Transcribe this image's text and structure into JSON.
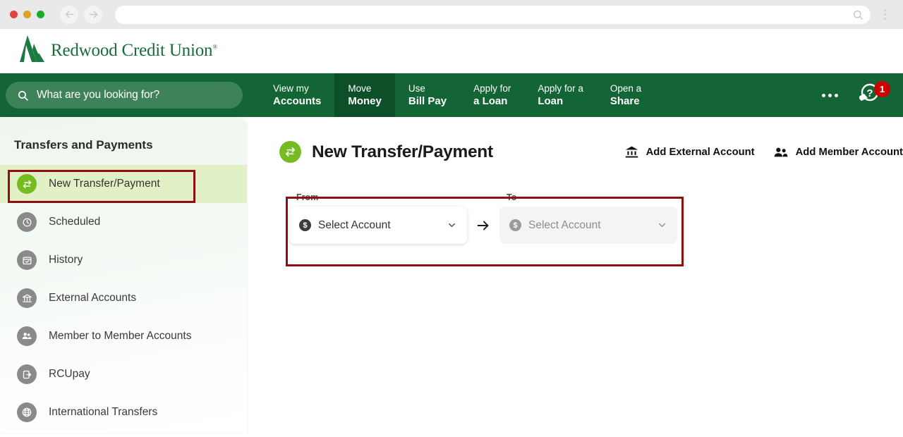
{
  "browser": {
    "back_label": "Back",
    "forward_label": "Forward",
    "url_value": "",
    "url_placeholder": "",
    "menu_label": "Browser menu"
  },
  "brand": {
    "name": "Redwood Credit Union",
    "trademark": "®",
    "green": "#1a6b3c"
  },
  "topnav": {
    "background": "#136535",
    "active_background": "#0d4f28",
    "search": {
      "placeholder": "What are you looking for?",
      "value": ""
    },
    "items": [
      {
        "line1": "View my",
        "line2": "Accounts",
        "active": false
      },
      {
        "line1": "Move",
        "line2": "Money",
        "active": true
      },
      {
        "line1": "Use",
        "line2": "Bill Pay",
        "active": false
      },
      {
        "line1": "Apply for",
        "line2": "a Loan",
        "active": false
      },
      {
        "line1": "Apply for a",
        "line2": "Loan",
        "active": false
      },
      {
        "line1": "Open a",
        "line2": "Share",
        "active": false
      }
    ],
    "more_label": "More",
    "help": {
      "label": "Help and chat",
      "badge_count": "1",
      "badge_color": "#cc0000"
    }
  },
  "sidebar": {
    "title": "Transfers and Payments",
    "active_background": "#e2f0c6",
    "active_icon_color": "#76bc21",
    "items": [
      {
        "label": "New Transfer/Payment",
        "icon": "transfer-arrows-icon",
        "active": true
      },
      {
        "label": "Scheduled",
        "icon": "clock-icon",
        "active": false
      },
      {
        "label": "History",
        "icon": "calendar-check-icon",
        "active": false
      },
      {
        "label": "External Accounts",
        "icon": "bank-icon",
        "active": false
      },
      {
        "label": "Member to Member Accounts",
        "icon": "people-icon",
        "active": false
      },
      {
        "label": "RCUpay",
        "icon": "payment-card-icon",
        "active": false
      },
      {
        "label": "International Transfers",
        "icon": "globe-icon",
        "active": false
      }
    ]
  },
  "main": {
    "page_title": "New Transfer/Payment",
    "page_icon": "transfer-arrows-icon",
    "actions": [
      {
        "label": "Add External Account",
        "icon": "bank-icon"
      },
      {
        "label": "Add Member Account",
        "icon": "people-icon"
      }
    ],
    "form": {
      "from": {
        "label": "From",
        "selected_value": "Select Account",
        "icon": "dollar-coin-icon",
        "disabled": false
      },
      "direction_icon": "arrow-right-icon",
      "to": {
        "label": "To",
        "selected_value": "Select Account",
        "icon": "dollar-coin-icon",
        "disabled": true
      }
    }
  },
  "annotations": {
    "color": "#8f0f13",
    "boxes": [
      {
        "target": "sidebar-item-new-transfer-payment"
      },
      {
        "target": "transfer-form-row"
      }
    ]
  }
}
